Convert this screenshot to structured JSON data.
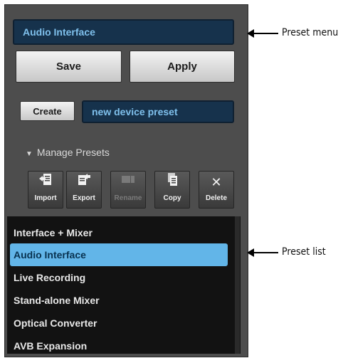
{
  "preset_menu": {
    "value": "Audio Interface"
  },
  "buttons": {
    "save": "Save",
    "apply": "Apply",
    "create": "Create"
  },
  "preset_name_field": {
    "value": "new device preset"
  },
  "manage_presets": {
    "label": "Manage Presets"
  },
  "toolbar": [
    {
      "label": "Import",
      "icon": "import-icon"
    },
    {
      "label": "Export",
      "icon": "export-icon"
    },
    {
      "label": "Rename",
      "icon": "rename-icon",
      "enabled": false
    },
    {
      "label": "Copy",
      "icon": "copy-icon"
    },
    {
      "label": "Delete",
      "icon": "close-icon"
    }
  ],
  "preset_list": {
    "items": [
      "Interface + Mixer",
      "Audio Interface",
      "Live Recording",
      "Stand-alone Mixer",
      "Optical Converter",
      "AVB Expansion"
    ],
    "selected": "Audio Interface"
  },
  "callouts": {
    "preset_menu": "Preset menu",
    "preset_list": "Preset list"
  },
  "colors": {
    "selection": "#62b5e8",
    "field_bg": "#16324c",
    "field_text": "#7fc0ec",
    "panel_bg": "#4d4d4d"
  }
}
